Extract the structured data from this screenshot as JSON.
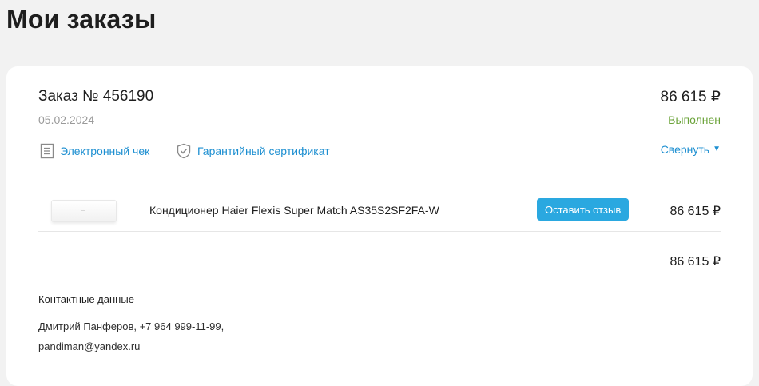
{
  "page": {
    "title": "Мои заказы"
  },
  "order": {
    "number": "Заказ № 456190",
    "date": "05.02.2024",
    "total": "86 615 ₽",
    "status": "Выполнен",
    "links": {
      "receipt": "Электронный чек",
      "warranty": "Гарантийный сертификат",
      "collapse": "Свернуть"
    },
    "items": [
      {
        "name": "Кондиционер Haier Flexis Super Match AS35S2SF2FA-W",
        "review_label": "Оставить отзыв",
        "price": "86 615 ₽"
      }
    ],
    "summary_total": "86 615 ₽"
  },
  "contacts": {
    "title": "Контактные данные",
    "line1": "Дмитрий Панферов, +7 964 999-11-99,",
    "line2": "pandiman@yandex.ru"
  },
  "colors": {
    "accent": "#1d8fd1",
    "button": "#2aa8e0",
    "status": "#6ba33a"
  }
}
